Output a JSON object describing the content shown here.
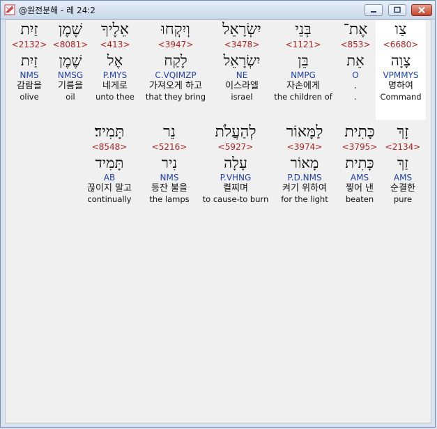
{
  "window": {
    "title": "@원전분해 - 레 24:2"
  },
  "colors": {
    "strong": "#b22222",
    "parse": "#1f3fb4",
    "selected_bg": "#ffffff"
  },
  "icons": {
    "app": "leaf-scroll-icon",
    "minimize": "minimize-icon",
    "maximize": "maximize-icon",
    "close": "close-icon"
  },
  "words": [
    {
      "heb": "צַו",
      "num": "<6680>",
      "lemma": "צָוָה",
      "parse": "VPMMYS",
      "kor": "명하여",
      "eng": "Command",
      "selected": true
    },
    {
      "heb": "אֶת־",
      "num": "<853>",
      "lemma": "אֵת",
      "parse": "O",
      "kor": ".",
      "eng": "."
    },
    {
      "heb": "בְּנֵי",
      "num": "<1121>",
      "lemma": "בֵּן",
      "parse": "NMPG",
      "kor": "자손에게",
      "eng": "the children of"
    },
    {
      "heb": "יִשְׂרָאֵל",
      "num": "<3478>",
      "lemma": "יִשְׂרָאֵל",
      "parse": "NE",
      "kor": "이스라엘",
      "eng": "israel"
    },
    {
      "heb": "וְיִקְחוּ",
      "num": "<3947>",
      "lemma": "לָקַח",
      "parse": "C.VQIMZP",
      "kor": "가져오게 하고",
      "eng": "that they bring"
    },
    {
      "heb": "אֵלֶיךָ",
      "num": "<413>",
      "lemma": "אֶל",
      "parse": "P.MYS",
      "kor": "네게로",
      "eng": "unto thee"
    },
    {
      "heb": "שֶׁמֶן",
      "num": "<8081>",
      "lemma": "שֶׁמֶן",
      "parse": "NMSG",
      "kor": "기름을",
      "eng": "oil"
    },
    {
      "heb": "זַיִת",
      "num": "<2132>",
      "lemma": "זַיִת",
      "parse": "NMS",
      "kor": "감람을",
      "eng": "olive"
    },
    {
      "heb": "זָךְ",
      "num": "<2134>",
      "lemma": "זַךְ",
      "parse": "AMS",
      "kor": "순결한",
      "eng": "pure"
    },
    {
      "heb": "כָּתִית",
      "num": "<3795>",
      "lemma": "כָּתִית",
      "parse": "AMS",
      "kor": "찧어 낸",
      "eng": "beaten"
    },
    {
      "heb": "לַמָּאוֹר",
      "num": "<3974>",
      "lemma": "מָאוֹר",
      "parse": "P.D.NMS",
      "kor": "켜기 위하여",
      "eng": "for the light"
    },
    {
      "heb": "לְהַעֲלֹת",
      "num": "<5927>",
      "lemma": "עָלָה",
      "parse": "P.VHNG",
      "kor": "켤찌며",
      "eng": "to cause-to burn"
    },
    {
      "heb": "נֵר",
      "num": "<5216>",
      "lemma": "נִיר",
      "parse": "NMS",
      "kor": "등잔 불을",
      "eng": "the lamps"
    },
    {
      "heb": "תָּמִיד׃",
      "num": "<8548>",
      "lemma": "תָּמִיד",
      "parse": "AB",
      "kor": "끊이지 말고",
      "eng": "continually"
    }
  ]
}
